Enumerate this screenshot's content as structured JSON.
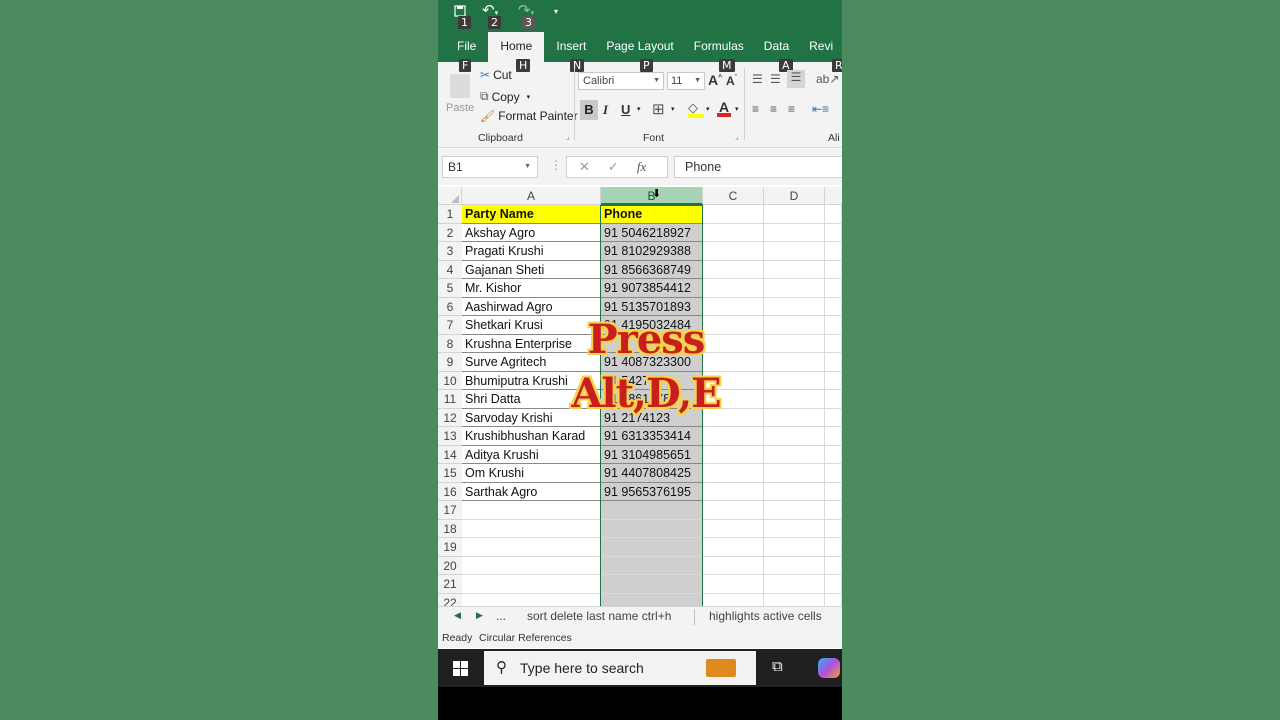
{
  "qat": {
    "keytips": [
      "1",
      "2",
      "3"
    ]
  },
  "tabs": [
    "File",
    "Home",
    "Insert",
    "Page Layout",
    "Formulas",
    "Data",
    "Revi"
  ],
  "ribbon_keytips": {
    "file": "F",
    "home": "H",
    "insert": "N",
    "page_layout": "P",
    "formulas": "M",
    "data": "A",
    "review": "R"
  },
  "clipboard": {
    "paste": "Paste",
    "cut": "Cut",
    "copy": "Copy",
    "format_painter": "Format Painter",
    "label": "Clipboard"
  },
  "font": {
    "name": "Calibri",
    "size": "11",
    "label": "Font",
    "bold": "B",
    "italic": "I",
    "underline": "U"
  },
  "alignment": {
    "label": "Ali"
  },
  "formula_bar": {
    "name_box": "B1",
    "formula": "Phone",
    "fx": "fx"
  },
  "columns": [
    "A",
    "B",
    "C",
    "D"
  ],
  "rows": [
    {
      "n": "1",
      "a": "Party Name",
      "b": "Phone"
    },
    {
      "n": "2",
      "a": "Akshay Agro",
      "b": "91 5046218927"
    },
    {
      "n": "3",
      "a": "Pragati Krushi",
      "b": "91 8102929388"
    },
    {
      "n": "4",
      "a": "Gajanan Sheti",
      "b": "91 8566368749"
    },
    {
      "n": "5",
      "a": "Mr. Kishor",
      "b": "91 9073854412"
    },
    {
      "n": "6",
      "a": "Aashirwad Agro",
      "b": "91 5135701893"
    },
    {
      "n": "7",
      "a": "Shetkari Krusi",
      "b": "91 4195032484"
    },
    {
      "n": "8",
      "a": "Krushna Enterprise",
      "b": ""
    },
    {
      "n": "9",
      "a": "Surve Agritech",
      "b": "91 4087323300"
    },
    {
      "n": "10",
      "a": "Bhumiputra Krushi",
      "b": "91 5427"
    },
    {
      "n": "11",
      "a": "Shri Datta",
      "b": "91 0861878"
    },
    {
      "n": "12",
      "a": "Sarvoday Krishi",
      "b": "91 2174123"
    },
    {
      "n": "13",
      "a": "Krushibhushan Karad",
      "b": "91 6313353414"
    },
    {
      "n": "14",
      "a": "Aditya Krushi",
      "b": "91 3104985651"
    },
    {
      "n": "15",
      "a": "Om Krushi",
      "b": "91 4407808425"
    },
    {
      "n": "16",
      "a": "Sarthak Agro",
      "b": "91 9565376195"
    },
    {
      "n": "17",
      "a": "",
      "b": ""
    },
    {
      "n": "18",
      "a": "",
      "b": ""
    },
    {
      "n": "19",
      "a": "",
      "b": ""
    },
    {
      "n": "20",
      "a": "",
      "b": ""
    },
    {
      "n": "21",
      "a": "",
      "b": ""
    },
    {
      "n": "22",
      "a": "",
      "b": ""
    }
  ],
  "caption": {
    "line1": "Press",
    "line2": "Alt,D,E"
  },
  "sheet_tabs": {
    "more": "...",
    "tab1": "sort delete last name ctrl+h",
    "tab2": "highlights active cells"
  },
  "status": {
    "ready": "Ready",
    "circular": "Circular References"
  },
  "taskbar": {
    "search_placeholder": "Type here to search"
  }
}
